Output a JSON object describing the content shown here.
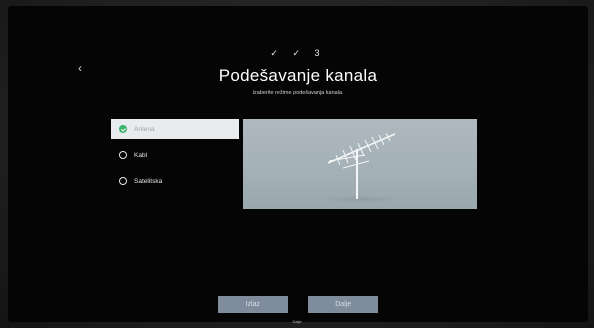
{
  "wizard": {
    "steps": [
      "✓",
      "✓",
      "3"
    ],
    "title": "Podešavanje kanala",
    "subtitle": "Izaberite režime podešavanja kanala."
  },
  "options": [
    {
      "label": "Antena",
      "selected": true
    },
    {
      "label": "Kabl",
      "selected": false
    },
    {
      "label": "Satelitska",
      "selected": false
    }
  ],
  "buttons": {
    "exit_label": "Izlaz",
    "next_label": "Dalje"
  },
  "footer": {
    "label": "Dalje"
  },
  "colors": {
    "accent_selected": "#3cb46e",
    "button_bg": "#7f8c9c",
    "preview_bg": "#a3b0b6"
  },
  "icons": {
    "back": "chevron-left-icon",
    "preview": "antenna-icon"
  }
}
